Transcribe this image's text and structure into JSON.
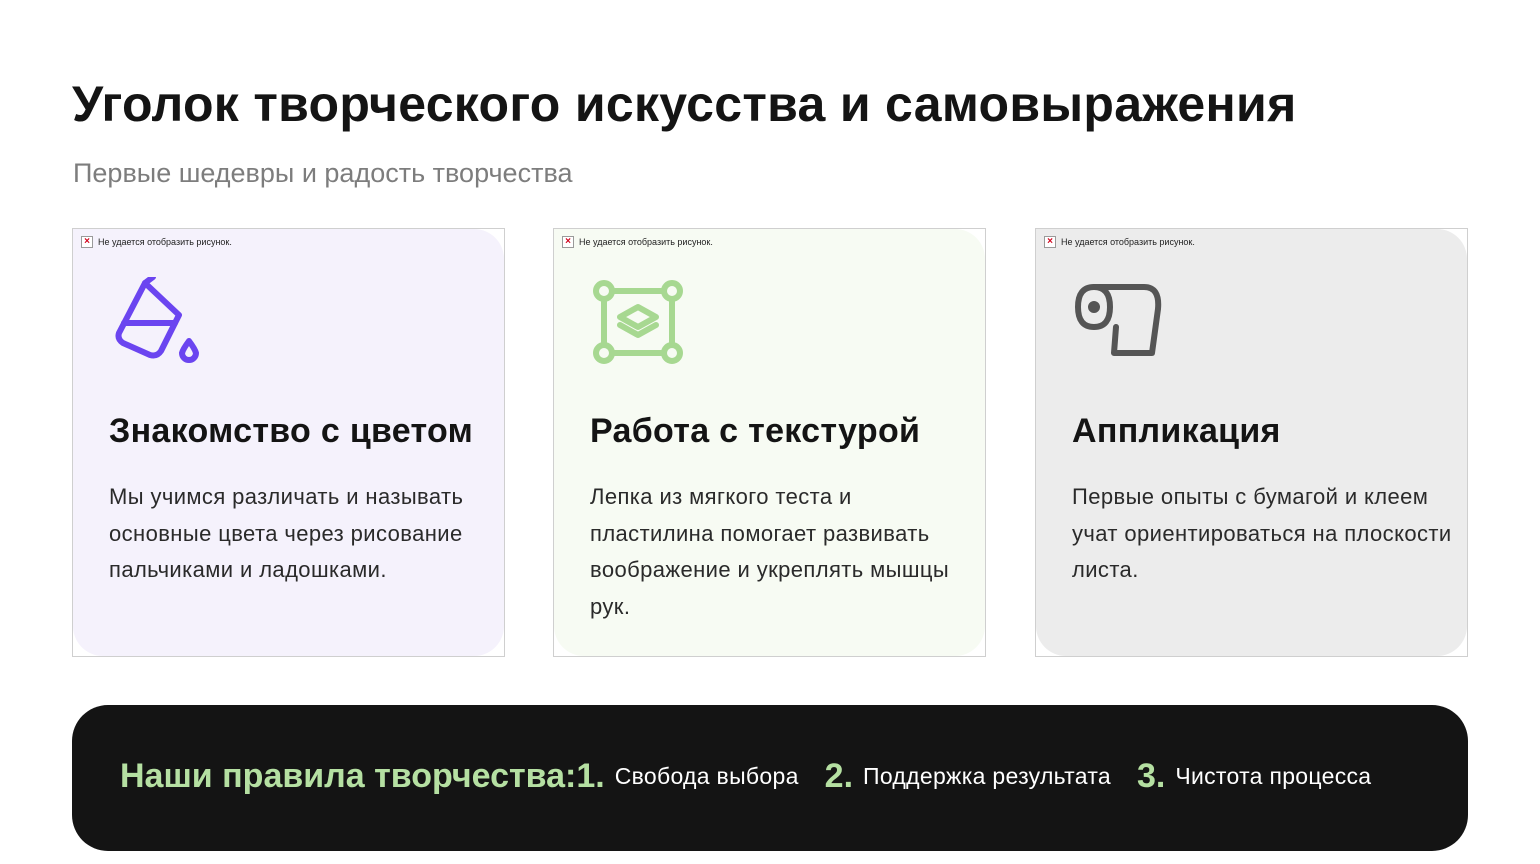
{
  "page": {
    "title": "Уголок творческого искусства и самовыражения",
    "subtitle": "Первые шедевры и радость творчества"
  },
  "broken_image_text": "Не удается отобразить рисунок.",
  "cards": [
    {
      "icon": "paint-bucket-icon",
      "title": "Знакомство с цветом",
      "text": "Мы учимся различать и называть основные цвета через рисование пальчиками и ладошками.",
      "accent": "#6b45f0",
      "background": "#f5f2fc"
    },
    {
      "icon": "layers-frame-icon",
      "title": "Работа с текстурой",
      "text": "Лепка из мягкого теста и пластилина помогает развивать воображение и укреплять мышцы рук.",
      "accent": "#a7d891",
      "background": "#f7fbf3"
    },
    {
      "icon": "paper-roll-icon",
      "title": "Аппликация",
      "text": "Первые опыты с бумагой и клеем учат ориентироваться на плоскости листа.",
      "accent": "#555555",
      "background": "#ececec"
    }
  ],
  "rules": {
    "heading": "Наши правила творчества:",
    "items": [
      {
        "number": "1.",
        "text": "Свобода выбора"
      },
      {
        "number": "2.",
        "text": "Поддержка результата"
      },
      {
        "number": "3.",
        "text": "Чистота процесса"
      }
    ],
    "background": "#141414",
    "accent": "#b5e0a2"
  }
}
